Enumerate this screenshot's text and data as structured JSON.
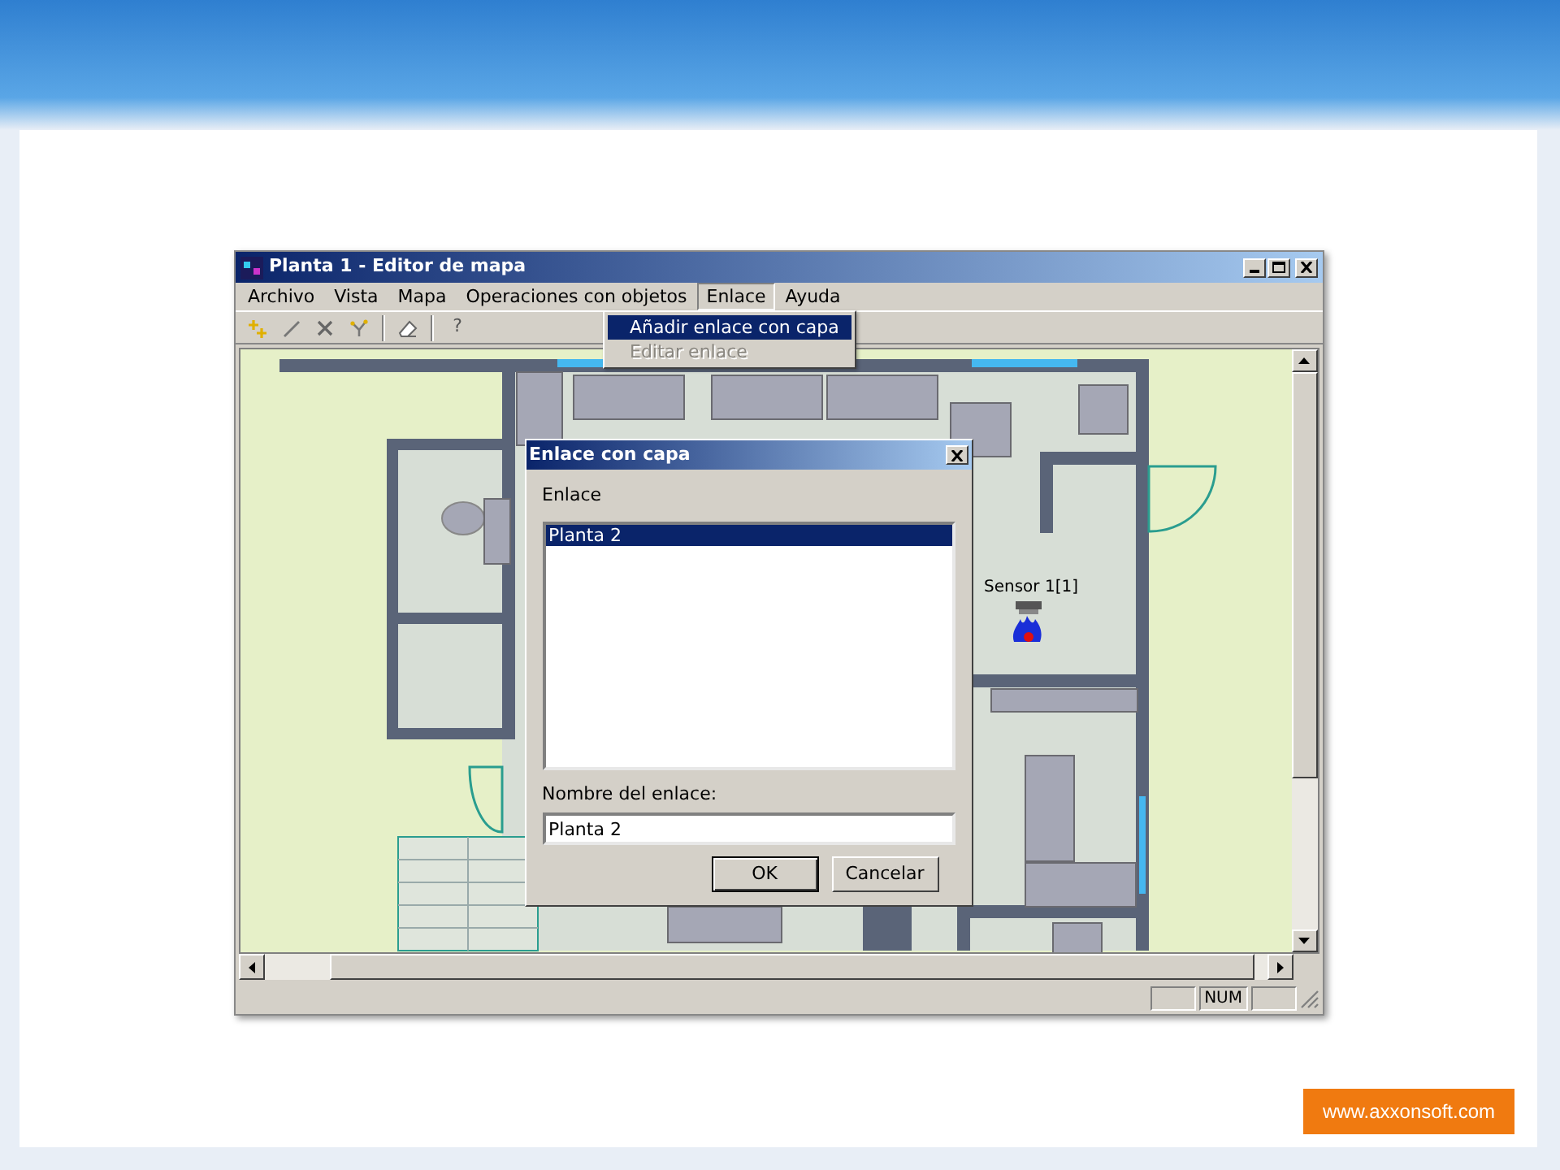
{
  "window": {
    "title": "Planta 1 - Editor de mapa"
  },
  "menu": [
    {
      "label": "Archivo",
      "selected": false
    },
    {
      "label": "Vista",
      "selected": false
    },
    {
      "label": "Mapa",
      "selected": false
    },
    {
      "label": "Operaciones con objetos",
      "selected": false
    },
    {
      "label": "Enlace",
      "selected": true
    },
    {
      "label": "Ayuda",
      "selected": false
    }
  ],
  "open_menu": [
    {
      "label": "Añadir enlace con capa",
      "selected": true,
      "disabled": false
    },
    {
      "label": "Editar enlace",
      "selected": false,
      "disabled": true
    }
  ],
  "toolbar": [
    {
      "kind": "add"
    },
    {
      "kind": "line"
    },
    {
      "kind": "delete"
    },
    {
      "kind": "link"
    },
    {
      "kind": "separator"
    },
    {
      "kind": "erase"
    },
    {
      "kind": "separator"
    },
    {
      "kind": "help",
      "label": "?"
    }
  ],
  "map": {
    "sensor_label": "Sensor 1[1]"
  },
  "dialog": {
    "title": "Enlace con capa",
    "list_label": "Enlace",
    "list_items": [
      {
        "label": "Planta 2",
        "selected": true
      }
    ],
    "name_label": "Nombre del enlace:",
    "name_value": "Planta 2",
    "buttons": [
      {
        "label": "OK",
        "default": true
      },
      {
        "label": "Cancelar",
        "default": false
      }
    ]
  },
  "status_bar": {
    "indicator": "NUM"
  },
  "footer": {
    "url": "www.axxonsoft.com"
  }
}
